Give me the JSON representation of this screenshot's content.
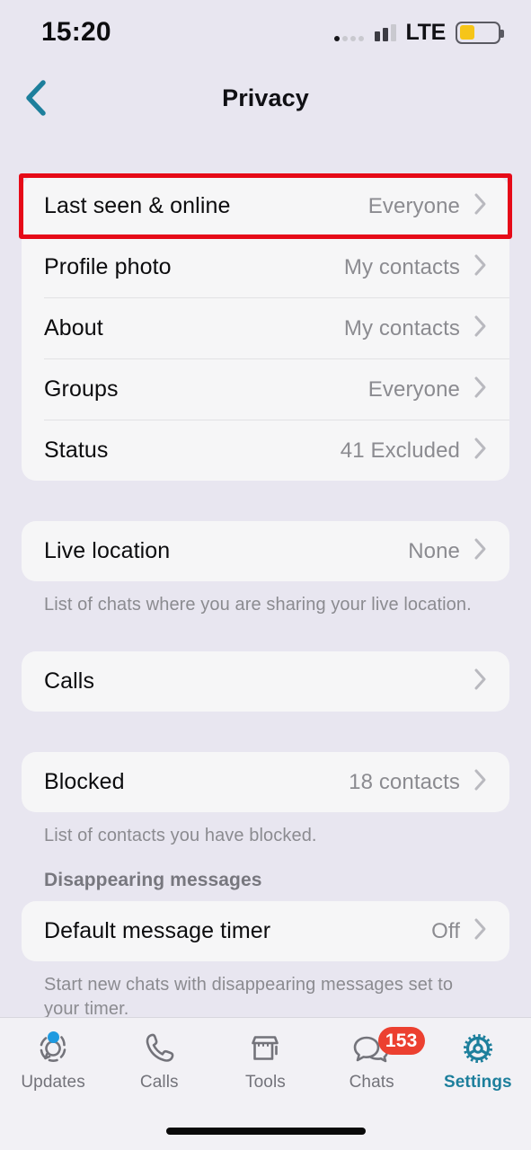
{
  "status_bar": {
    "time": "15:20",
    "network_label": "LTE",
    "signal_icon": "cellular-signal-icon",
    "battery_icon": "battery-icon",
    "battery_level_percent": 40,
    "battery_color": "#f6c518"
  },
  "nav": {
    "back_icon": "chevron-left-icon",
    "back_color": "#1d7f9c",
    "title": "Privacy"
  },
  "sections": [
    {
      "name": "visibility",
      "rows": [
        {
          "label": "Last seen & online",
          "value": "Everyone",
          "highlighted": true
        },
        {
          "label": "Profile photo",
          "value": "My contacts",
          "highlighted": false
        },
        {
          "label": "About",
          "value": "My contacts",
          "highlighted": false
        },
        {
          "label": "Groups",
          "value": "Everyone",
          "highlighted": false
        },
        {
          "label": "Status",
          "value": "41 Excluded",
          "highlighted": false
        }
      ]
    },
    {
      "name": "live-location",
      "rows": [
        {
          "label": "Live location",
          "value": "None"
        }
      ],
      "caption": "List of chats where you are sharing your live location."
    },
    {
      "name": "calls",
      "rows": [
        {
          "label": "Calls",
          "value": ""
        }
      ]
    },
    {
      "name": "blocked",
      "rows": [
        {
          "label": "Blocked",
          "value": "18 contacts"
        }
      ],
      "caption": "List of contacts you have blocked."
    },
    {
      "name": "disappearing-messages",
      "header": "Disappearing messages",
      "rows": [
        {
          "label": "Default message timer",
          "value": "Off"
        }
      ],
      "caption": "Start new chats with disappearing messages set to your timer."
    }
  ],
  "highlight": {
    "color": "#e60a18"
  },
  "tabbar": {
    "active_color": "#1d7f9c",
    "badge_color": "#ec4030",
    "tabs": [
      {
        "label": "Updates",
        "icon": "updates-status-icon",
        "active": false,
        "dot": true,
        "badge": ""
      },
      {
        "label": "Calls",
        "icon": "phone-icon",
        "active": false,
        "dot": false,
        "badge": ""
      },
      {
        "label": "Tools",
        "icon": "storefront-icon",
        "active": false,
        "dot": false,
        "badge": ""
      },
      {
        "label": "Chats",
        "icon": "chat-bubbles-icon",
        "active": false,
        "dot": false,
        "badge": "153"
      },
      {
        "label": "Settings",
        "icon": "gear-icon",
        "active": true,
        "dot": false,
        "badge": ""
      }
    ]
  }
}
